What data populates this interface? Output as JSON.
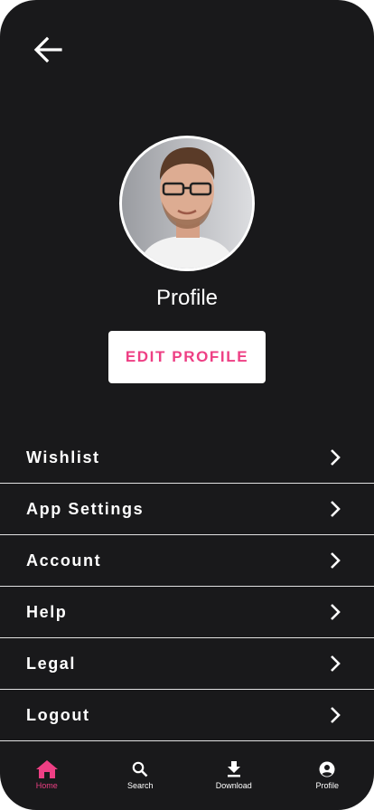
{
  "header": {
    "back_icon": "arrow-left-icon"
  },
  "profile": {
    "name": "Profile",
    "edit_button_label": "EDIT PROFILE",
    "avatar": "avatar-photo"
  },
  "menu": {
    "items": [
      {
        "label": "Wishlist",
        "icon": "chevron-right-icon"
      },
      {
        "label": "App Settings",
        "icon": "chevron-right-icon"
      },
      {
        "label": "Account",
        "icon": "chevron-right-icon"
      },
      {
        "label": "Help",
        "icon": "chevron-right-icon"
      },
      {
        "label": "Legal",
        "icon": "chevron-right-icon"
      },
      {
        "label": "Logout",
        "icon": "chevron-right-icon"
      }
    ]
  },
  "tabbar": {
    "items": [
      {
        "label": "Home",
        "icon": "home-icon",
        "active": true
      },
      {
        "label": "Search",
        "icon": "search-icon",
        "active": false
      },
      {
        "label": "Download",
        "icon": "download-icon",
        "active": false
      },
      {
        "label": "Profile",
        "icon": "account-circle-icon",
        "active": false
      }
    ]
  },
  "colors": {
    "background": "#19191b",
    "accent": "#ee3f84",
    "text": "#ffffff",
    "divider": "#e2e2e2"
  }
}
